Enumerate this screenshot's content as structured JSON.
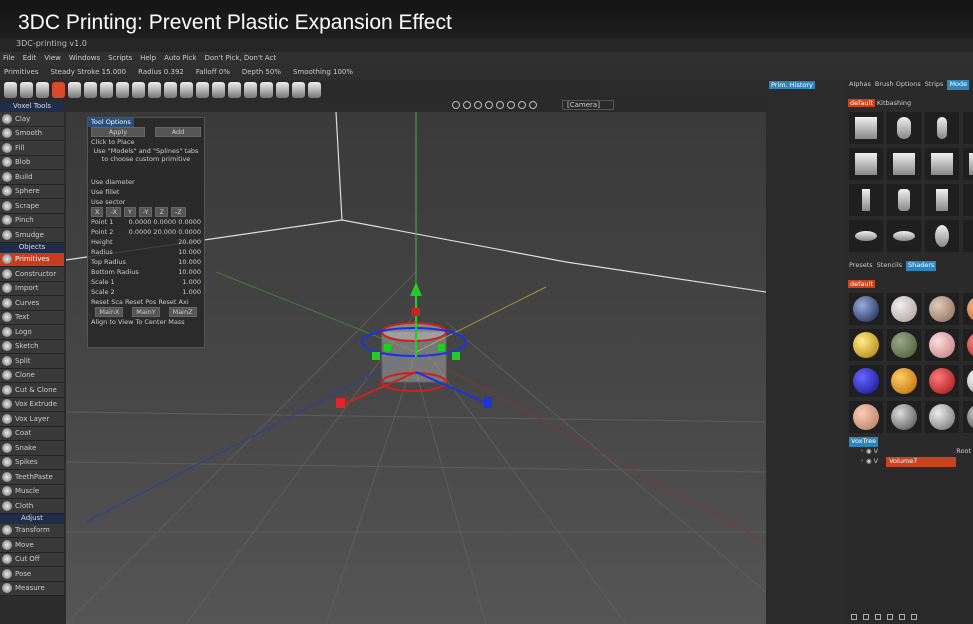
{
  "video": {
    "title": "3DC Printing: Prevent Plastic Expansion Effect"
  },
  "app": {
    "title": "3DC-printing v1.0"
  },
  "menu": [
    "File",
    "Edit",
    "View",
    "Windows",
    "Scripts",
    "Help",
    "Auto Pick",
    "Don't Pick, Don't Act"
  ],
  "params": {
    "mode": "Primitives",
    "steady_stroke": "Steady Stroke  15.000",
    "radius": "Radius 0.392",
    "falloff": "Falloff  0%",
    "depth": "Depth  50%",
    "smoothing": "Smoothing  100%"
  },
  "viewport": {
    "camera": "[Camera]"
  },
  "left_panel": {
    "voxel_tools_header": "Voxel Tools",
    "voxel_tools": [
      "Clay",
      "Smooth",
      "Fill",
      "Blob",
      "Build",
      "Sphere",
      "Scrape",
      "Pinch",
      "Smudge"
    ],
    "objects_header": "Objects",
    "objects": [
      "Primitives",
      "Constructor",
      "Import",
      "Curves",
      "Text",
      "Logo",
      "Sketch",
      "Split",
      "Clone",
      "Cut & Clone",
      "Vox Extrude",
      "Vox Layer",
      "Coat",
      "Snake",
      "Spikes",
      "TeethPaste",
      "Muscle",
      "Cloth"
    ],
    "adjust_header": "Adjust",
    "adjust": [
      "Transform",
      "Move",
      "Cut Off",
      "Pose",
      "Measure"
    ]
  },
  "tool_options": {
    "title": "Tool Options",
    "apply": "Apply",
    "mode": "Add",
    "click_to_place": "Click to Place",
    "hint": "Use \"Models\" and \"Splines\" tabs to choose custom primitive",
    "use_diameter": "Use diameter",
    "use_fillet": "Use fillet",
    "use_sector": "Use sector",
    "axes": [
      "X",
      "-X",
      "Y",
      "-Y",
      "Z",
      "-Z"
    ],
    "point1_label": "Point 1",
    "point1": "0.0000  0.0000  0.0000",
    "point2_label": "Point 2",
    "point2": "0.0000  20.000  0.0000",
    "fields": [
      {
        "label": "Height",
        "value": "20.000"
      },
      {
        "label": "Radius",
        "value": "10.000"
      },
      {
        "label": "Top Radius",
        "value": "10.000"
      },
      {
        "label": "Bottom Radius",
        "value": "10.000"
      },
      {
        "label": "Scale 1",
        "value": "1.000"
      },
      {
        "label": "Scale 2",
        "value": "1.000"
      }
    ],
    "resets": "Reset Sca  Reset Pos  Reset Axi",
    "main_buttons": [
      "MainX",
      "MainY",
      "MainZ"
    ],
    "align_row": "Align to View  To Center Mass"
  },
  "right_panel": {
    "tabs": [
      "Alphas",
      "Brush Options",
      "Strips",
      "Mode"
    ],
    "preset": "default",
    "preset2": "Kitbashing",
    "lower_tabs": [
      "Presets",
      "Stencils",
      "Shaders"
    ],
    "shader_preset": "default",
    "prim_history": "Prim. History",
    "voxtree_tab": "VoxTree",
    "root": "Root",
    "volume": "Volume7"
  },
  "colors": {
    "accent_orange": "#c8431e",
    "accent_blue": "#2e86b8",
    "gizmo_red": "#e0262a",
    "gizmo_green": "#22cc22",
    "gizmo_blue": "#1a34e0"
  }
}
